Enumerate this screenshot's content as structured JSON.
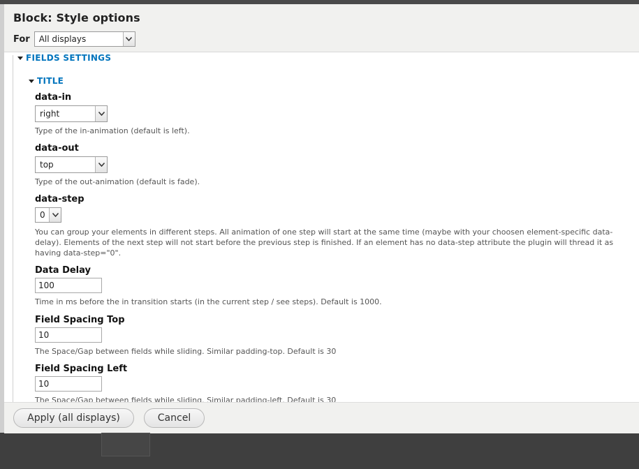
{
  "dialog": {
    "title": "Block: Style options",
    "for_label": "For",
    "for_select": "All displays"
  },
  "fieldsets": {
    "fields_settings": "FIELDS SETTINGS",
    "title_section": "TITLE"
  },
  "fields": {
    "data_in": {
      "label": "data-in",
      "value": "right",
      "description": "Type of the in-animation (default is left)."
    },
    "data_out": {
      "label": "data-out",
      "value": "top",
      "description": "Type of the out-animation (default is fade)."
    },
    "data_step": {
      "label": "data-step",
      "value": "0",
      "description": "You can group your elements in different steps. All animation of one step will start at the same time (maybe with your choosen element-specific data-delay). Elements of the next step will not start before the previous step is finished. If an element has no data-step attribute the plugin will thread it as having data-step=\"0\"."
    },
    "data_delay": {
      "label": "Data Delay",
      "value": "100",
      "description": "Time in ms before the in transition starts (in the current step / see steps). Default is 1000."
    },
    "field_spacing_top": {
      "label": "Field Spacing Top",
      "value": "10",
      "description": "The Space/Gap between fields while sliding. Similar padding-top. Default is 30"
    },
    "field_spacing_left": {
      "label": "Field Spacing Left",
      "value": "10",
      "description": "The Space/Gap between fields while sliding. Similar padding-left. Default is 30"
    }
  },
  "footer": {
    "apply_label": "Apply (all displays)",
    "cancel_label": "Cancel"
  }
}
